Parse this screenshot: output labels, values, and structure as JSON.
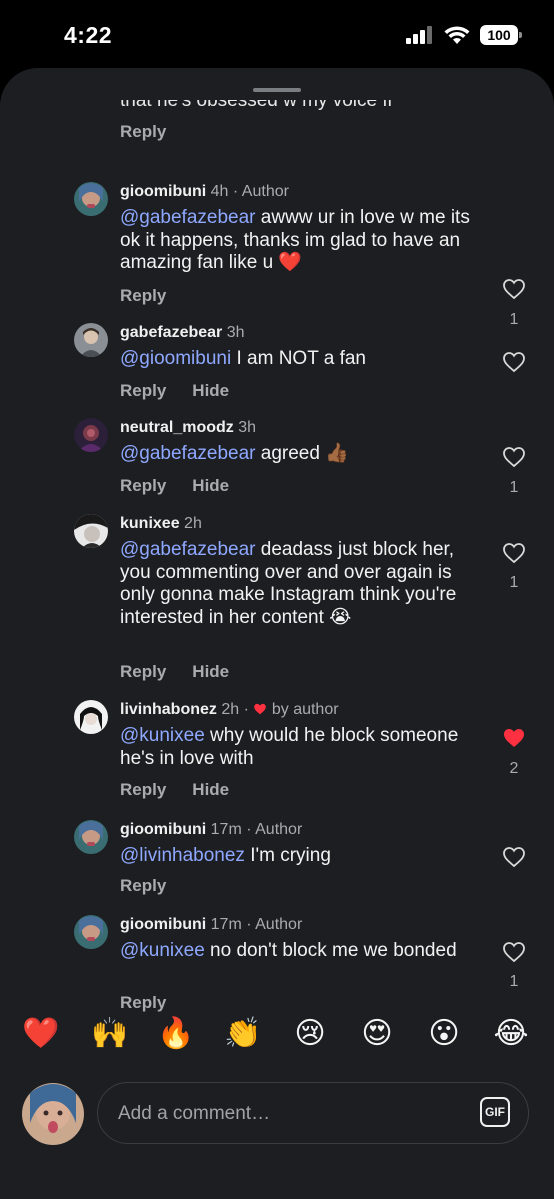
{
  "status_bar": {
    "time": "4:22",
    "battery": "100"
  },
  "top_cut": {
    "text": "that he's obsessed w my voice fr",
    "reply": "Reply"
  },
  "comments": [
    {
      "username": "gioomibuni",
      "time": "4h",
      "tag": "· Author",
      "mention": "@gabefazebear",
      "text": " awww ur in love w me its ok it happens, thanks im glad to have an amazing fan like u ❤️",
      "reply": "Reply",
      "hide": "",
      "likes": "1",
      "liked": false
    },
    {
      "username": "gabefazebear",
      "time": "3h",
      "tag": "",
      "mention": "@gioomibuni",
      "text": " I am NOT a fan",
      "reply": "Reply",
      "hide": "Hide",
      "likes": "",
      "liked": false
    },
    {
      "username": "neutral_moodz",
      "time": "3h",
      "tag": "",
      "mention": "@gabefazebear",
      "text": " agreed 👍🏾",
      "reply": "Reply",
      "hide": "Hide",
      "likes": "1",
      "liked": false
    },
    {
      "username": "kunixee",
      "time": "2h",
      "tag": "",
      "mention": "@gabefazebear",
      "text": " deadass just block her, you commenting over and over again is only gonna make Instagram think you're interested in her content 😭",
      "reply": "Reply",
      "hide": "Hide",
      "likes": "1",
      "liked": false
    },
    {
      "username": "livinhabonez",
      "time": "2h",
      "tag": "by author",
      "mention": "@kunixee",
      "text": " why would he block someone he's in love with",
      "reply": "Reply",
      "hide": "Hide",
      "likes": "2",
      "liked": true
    },
    {
      "username": "gioomibuni",
      "time": "17m",
      "tag": "· Author",
      "mention": "@livinhabonez",
      "text": " I'm crying",
      "reply": "Reply",
      "hide": "",
      "likes": "",
      "liked": false
    },
    {
      "username": "gioomibuni",
      "time": "17m",
      "tag": "· Author",
      "mention": "@kunixee",
      "text": " no don't block me we bonded",
      "reply": "Reply",
      "hide": "",
      "likes": "1",
      "liked": false
    }
  ],
  "emoji_bar": [
    "❤️",
    "🙌",
    "🔥",
    "👏",
    "😢",
    "😍",
    "😮",
    "😂"
  ],
  "composer": {
    "placeholder": "Add a comment…",
    "gif_label": "GIF"
  },
  "colors": {
    "mention": "#8fa8ff",
    "liked_heart": "#ff3040",
    "sheet": "#1c1e21"
  }
}
